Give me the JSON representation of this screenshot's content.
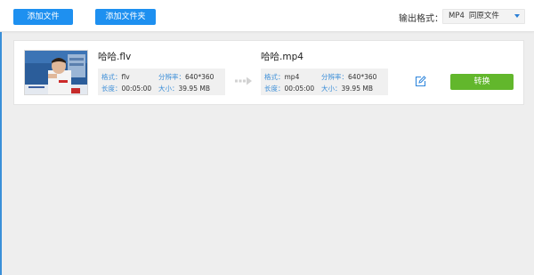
{
  "toolbar": {
    "add_file_label": "添加文件",
    "add_folder_label": "添加文件夹",
    "output_format_label": "输出格式：",
    "output_format_value": "MP4",
    "output_format_sub": "同原文件"
  },
  "file": {
    "source": {
      "name": "哈哈.flv",
      "format_label": "格式：",
      "format_value": "flv",
      "resolution_label": "分辨率：",
      "resolution_value": "640*360",
      "duration_label": "长度：",
      "duration_value": "00:05:00",
      "size_label": "大小：",
      "size_value": "39.95 MB"
    },
    "target": {
      "name": "哈哈.mp4",
      "format_label": "格式：",
      "format_value": "mp4",
      "resolution_label": "分辨率：",
      "resolution_value": "640*360",
      "duration_label": "长度：",
      "duration_value": "00:05:00",
      "size_label": "大小：",
      "size_value": "39.95 MB"
    },
    "convert_label": "转换"
  },
  "icons": {
    "arrow": "arrow-right-icon",
    "edit": "edit-icon",
    "dropdown": "caret-down-icon"
  },
  "colors": {
    "primary_blue": "#1e90f0",
    "convert_green": "#62b72c",
    "label_blue": "#3b8ed8",
    "background": "#eeeeee"
  }
}
